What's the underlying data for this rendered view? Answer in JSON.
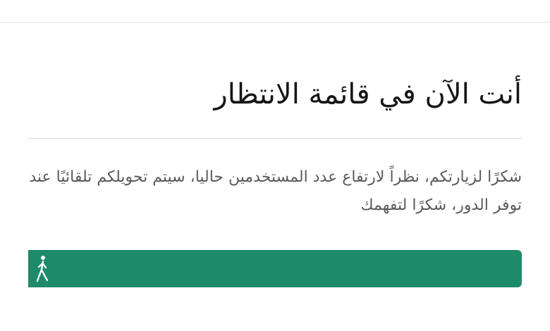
{
  "queue": {
    "title": "أنت الآن في قائمة الانتظار",
    "message": "شكرًا لزيارتكم، نظراً لارتفاع عدد المستخدمين حاليا، سيتم تحويلكم تلقائيًا عند توفر الدور، شكرًا لتفهمك",
    "progress_percent": 100,
    "progress_color": "#1d8a6a",
    "icon": "walking-person-icon"
  }
}
